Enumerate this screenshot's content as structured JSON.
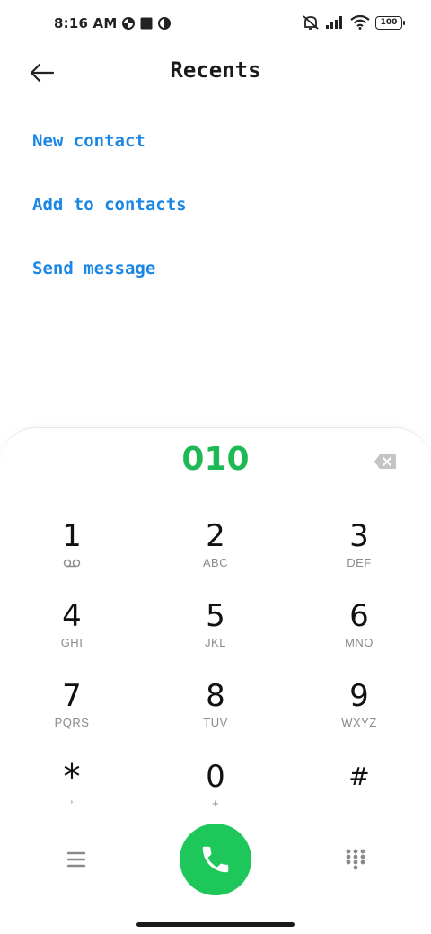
{
  "status_bar": {
    "time": "8:16 AM",
    "battery": "100",
    "icons": [
      "data-saver-icon",
      "square-notification-icon",
      "data-saver-icon",
      "mute-vibrate-icon",
      "signal-icon",
      "wifi-icon",
      "battery-icon"
    ]
  },
  "header": {
    "title": "Recents",
    "back_icon": "back-arrow-icon"
  },
  "actions": {
    "new_contact": "New contact",
    "add_to_contacts": "Add to contacts",
    "send_message": "Send message"
  },
  "dialer": {
    "number": "010",
    "keys": [
      {
        "digit": "1",
        "letters": "",
        "sub_icon": "voicemail-icon"
      },
      {
        "digit": "2",
        "letters": "ABC"
      },
      {
        "digit": "3",
        "letters": "DEF"
      },
      {
        "digit": "4",
        "letters": "GHI"
      },
      {
        "digit": "5",
        "letters": "JKL"
      },
      {
        "digit": "6",
        "letters": "MNO"
      },
      {
        "digit": "7",
        "letters": "PQRS"
      },
      {
        "digit": "8",
        "letters": "TUV"
      },
      {
        "digit": "9",
        "letters": "WXYZ"
      },
      {
        "digit": "*",
        "letters": ","
      },
      {
        "digit": "0",
        "letters": "+"
      },
      {
        "digit": "#",
        "letters": ""
      }
    ],
    "call_icon": "phone-icon",
    "menu_icon": "menu-icon",
    "keypad_icon": "dialpad-icon"
  },
  "colors": {
    "accent_blue": "#1a86e6",
    "number_green": "#1db954",
    "call_green": "#1dc75a"
  }
}
